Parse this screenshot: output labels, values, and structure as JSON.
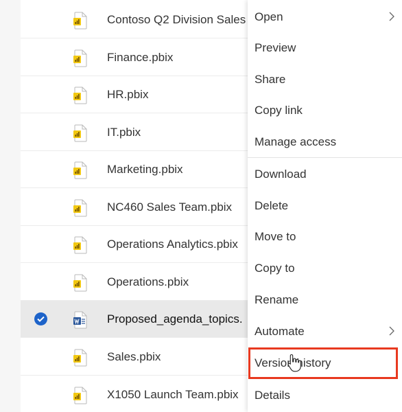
{
  "files": [
    {
      "name": "Contoso Q2 Division Sales",
      "icon": "pbix-file-icon",
      "selected": false
    },
    {
      "name": "Finance.pbix",
      "icon": "pbix-file-icon",
      "selected": false
    },
    {
      "name": "HR.pbix",
      "icon": "pbix-file-icon",
      "selected": false
    },
    {
      "name": "IT.pbix",
      "icon": "pbix-file-icon",
      "selected": false
    },
    {
      "name": "Marketing.pbix",
      "icon": "pbix-file-icon",
      "selected": false
    },
    {
      "name": "NC460 Sales Team.pbix",
      "icon": "pbix-file-icon",
      "selected": false
    },
    {
      "name": "Operations Analytics.pbix",
      "icon": "pbix-file-icon",
      "selected": false
    },
    {
      "name": "Operations.pbix",
      "icon": "pbix-file-icon",
      "selected": false
    },
    {
      "name": "Proposed_agenda_topics.",
      "icon": "word-file-icon",
      "selected": true
    },
    {
      "name": "Sales.pbix",
      "icon": "pbix-file-icon",
      "selected": false
    },
    {
      "name": "X1050 Launch Team.pbix",
      "icon": "pbix-file-icon",
      "selected": false
    }
  ],
  "context_menu": {
    "items": [
      {
        "label": "Open",
        "has_submenu": true
      },
      {
        "label": "Preview",
        "has_submenu": false
      },
      {
        "label": "Share",
        "has_submenu": false
      },
      {
        "label": "Copy link",
        "has_submenu": false
      },
      {
        "label": "Manage access",
        "has_submenu": false
      },
      {
        "label": "Download",
        "has_submenu": false
      },
      {
        "label": "Delete",
        "has_submenu": false
      },
      {
        "label": "Move to",
        "has_submenu": false
      },
      {
        "label": "Copy to",
        "has_submenu": false
      },
      {
        "label": "Rename",
        "has_submenu": false
      },
      {
        "label": "Automate",
        "has_submenu": true
      },
      {
        "label": "Version history",
        "has_submenu": false,
        "highlighted": true
      },
      {
        "label": "Details",
        "has_submenu": false
      }
    ]
  },
  "colors": {
    "accent": "#1d63c9",
    "highlight": "#e8391f",
    "pbix_icon": "#f2c811",
    "word_icon": "#2b579a"
  }
}
